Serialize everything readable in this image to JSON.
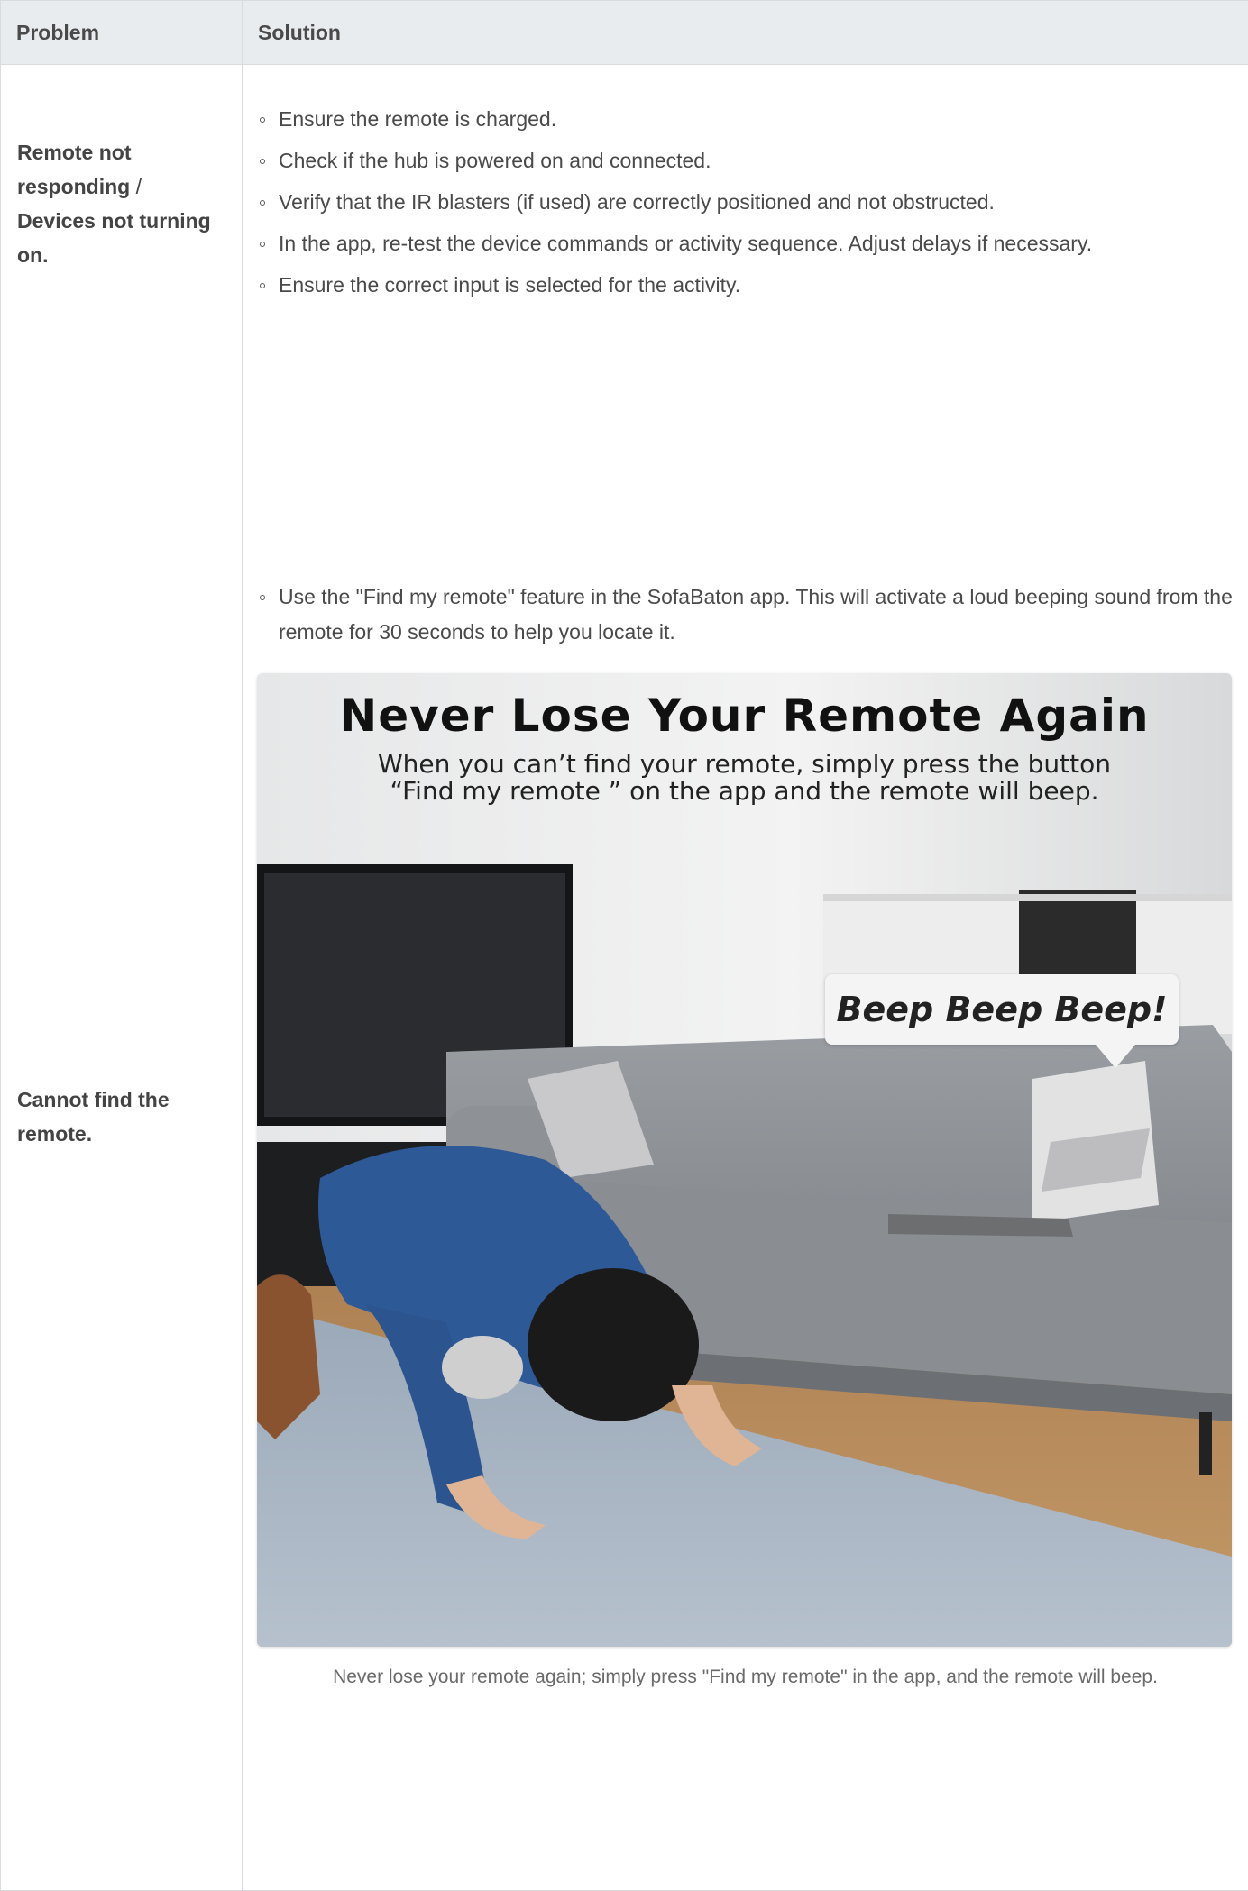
{
  "table": {
    "headers": {
      "problem": "Problem",
      "solution": "Solution"
    },
    "rows": [
      {
        "problem_bold_1": "Remote not responding",
        "problem_sep": " / ",
        "problem_bold_2": "Devices not turning on.",
        "solutions": [
          "Ensure the remote is charged.",
          "Check if the hub is powered on and connected.",
          "Verify that the IR blasters (if used) are correctly positioned and not obstructed.",
          "In the app, re-test the device commands or activity sequence. Adjust delays if necessary.",
          "Ensure the correct input is selected for the activity."
        ]
      },
      {
        "problem": "Cannot find the remote.",
        "solutions": [
          "Use the \"Find my remote\" feature in the SofaBaton app. This will activate a loud beeping sound from the remote for 30 seconds to help you locate it."
        ],
        "figure": {
          "title": "Never Lose Your Remote Again",
          "subtitle_line1": "When you can’t find your remote, simply press the button",
          "subtitle_line2": "“Find my remote ”  on the app and the remote will beep.",
          "bubble": "Beep Beep Beep!",
          "caption": "Never lose your remote again; simply press \"Find my remote\" in the app, and the remote will beep."
        }
      }
    ]
  }
}
